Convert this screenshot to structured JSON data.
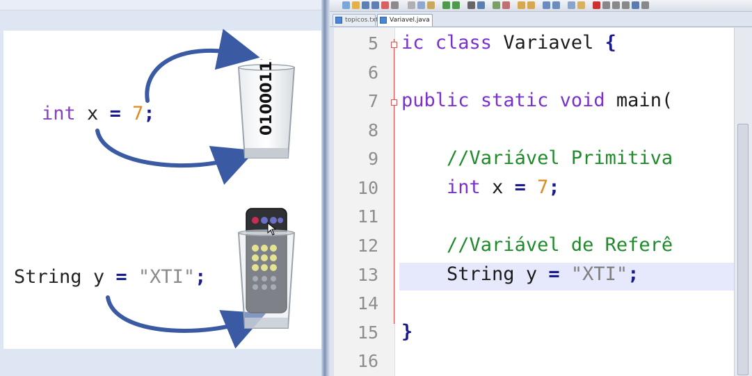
{
  "slide": {
    "line1": {
      "type": "int",
      "name": "x",
      "op": "=",
      "value": "7",
      "end": ";"
    },
    "line2": {
      "type": "String",
      "name": "y",
      "op": "=",
      "value": "\"XTI\"",
      "end": ";"
    },
    "binary_label": "01000111"
  },
  "editor": {
    "tabs": [
      {
        "label": "topicos.txt",
        "active": false
      },
      {
        "label": "Variavel.java",
        "active": true
      }
    ],
    "lines": [
      {
        "num": "5",
        "text": "ic class Variavel {"
      },
      {
        "num": "6",
        "text": ""
      },
      {
        "num": "7",
        "text": "public static void main("
      },
      {
        "num": "8",
        "text": ""
      },
      {
        "num": "9",
        "text": "    //Variável Primitiva"
      },
      {
        "num": "10",
        "text": "    int x = 7;"
      },
      {
        "num": "11",
        "text": ""
      },
      {
        "num": "12",
        "text": "    //Variável de Referê"
      },
      {
        "num": "13",
        "text": "    String y = \"XTI\";"
      },
      {
        "num": "14",
        "text": ""
      },
      {
        "num": "15",
        "text": "}"
      },
      {
        "num": "16",
        "text": ""
      }
    ],
    "tokens": {
      "l5_ic": "ic",
      "l5_class": "class",
      "l5_name": "Variavel",
      "l5_brace": "{",
      "l7_public": "public",
      "l7_static": "static",
      "l7_void": "void",
      "l7_main": "main(",
      "l9_comment": "//Variável Primitiva",
      "l10_int": "int",
      "l10_x": "x",
      "l10_eq": "=",
      "l10_7": "7",
      "l10_semi": ";",
      "l12_comment": "//Variável de Referê",
      "l13_String": "String",
      "l13_y": "y",
      "l13_eq": "=",
      "l13_str": "\"XTI\"",
      "l13_semi": ";",
      "l15_brace": "}"
    }
  }
}
